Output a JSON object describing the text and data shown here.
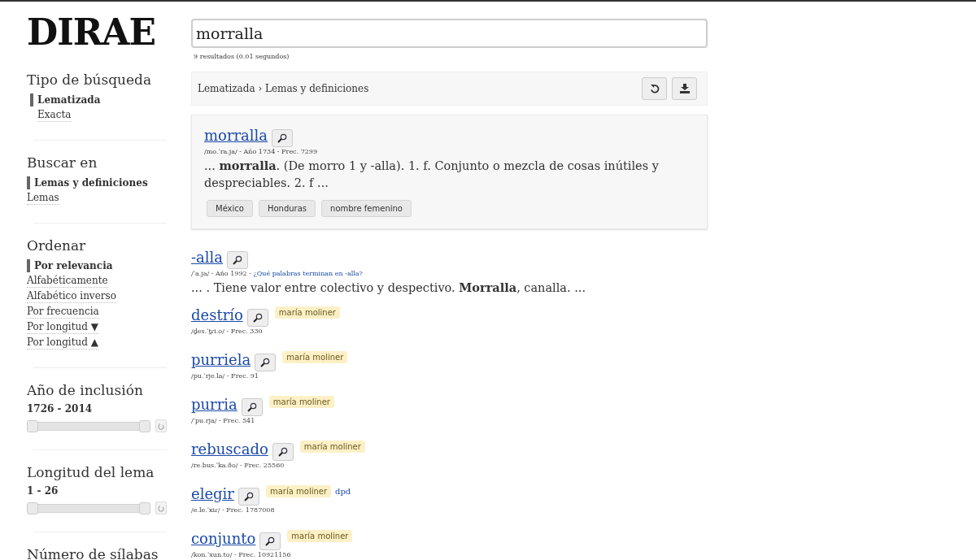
{
  "logo": "DIRAE",
  "search": {
    "value": "morralla",
    "stats": "9 resultados (0.01 segundos)"
  },
  "sidebar": {
    "sections": [
      {
        "kind": "options",
        "title": "Tipo de búsqueda",
        "options": [
          {
            "label": "Lematizada",
            "selected": true
          },
          {
            "label": "Exacta",
            "selected": false
          }
        ]
      },
      {
        "kind": "options",
        "title": "Buscar en",
        "options": [
          {
            "label": "Lemas y definiciones",
            "selected": true
          },
          {
            "label": "Lemas",
            "selected": false
          }
        ]
      },
      {
        "kind": "options",
        "title": "Ordenar",
        "options": [
          {
            "label": "Por relevancia",
            "selected": true
          },
          {
            "label": "Alfabéticamente",
            "selected": false
          },
          {
            "label": "Alfabético inverso",
            "selected": false
          },
          {
            "label": "Por frecuencia",
            "selected": false
          },
          {
            "label": "Por longitud ▼",
            "selected": false
          },
          {
            "label": "Por longitud ▲",
            "selected": false
          }
        ]
      },
      {
        "kind": "range",
        "title": "Año de inclusión",
        "range": "1726 - 2014",
        "level": 1
      },
      {
        "kind": "range",
        "title": "Longitud del lema",
        "range": "1 - 26",
        "level": 1
      },
      {
        "kind": "heading",
        "title": "Número de sílabas"
      }
    ]
  },
  "breadcrumb": "Lematizada › Lemas y definiciones",
  "results": [
    {
      "word": "morralla",
      "kind": "featured",
      "meta": "/mo.ˈra.ja/ - Año 1734 - Frec. 7299",
      "snippet": "... **morralla**. (De morro 1 y -alla). 1. f. Conjunto o mezcla de cosas inútiles y despreciables. 2. f ...",
      "tags": [
        "México",
        "Honduras",
        "nombre femenino"
      ]
    },
    {
      "word": "-alla",
      "kind": "plain",
      "meta": "/ˈa.ja/ - Año 1992 - ",
      "meta_link": "¿Qué palabras terminan en -alla?",
      "snippet": "... . Tiene valor entre colectivo y despectivo. **Morralla**, canalla. ..."
    },
    {
      "word": "destrío",
      "kind": "plain",
      "meta": "/d̪es.ˈt̪ɾi.o/ - Frec. 330",
      "badges": [
        {
          "kind": "source",
          "label": "maría moliner"
        }
      ]
    },
    {
      "word": "purriela",
      "kind": "plain",
      "meta": "/pu.ˈrje.la/ - Frec. 91",
      "badges": [
        {
          "kind": "source",
          "label": "maría moliner"
        }
      ]
    },
    {
      "word": "purria",
      "kind": "plain",
      "meta": "/ˈpu.rja/ - Frec. 541",
      "badges": [
        {
          "kind": "source",
          "label": "maría moliner"
        }
      ]
    },
    {
      "word": "rebuscado",
      "kind": "plain",
      "meta": "/re.bus.ˈka.ðo/ - Frec. 25560",
      "badges": [
        {
          "kind": "source",
          "label": "maría moliner"
        }
      ]
    },
    {
      "word": "elegir",
      "kind": "plain",
      "meta": "/e.le.ˈxiɾ/ - Frec. 1787008",
      "badges": [
        {
          "kind": "source",
          "label": "maría moliner"
        },
        {
          "kind": "link",
          "label": "dpd"
        }
      ]
    },
    {
      "word": "conjunto",
      "kind": "plain",
      "meta": "/kon.ˈxun.to/ - Frec. 10921156",
      "badges": [
        {
          "kind": "source",
          "label": "maría moliner"
        }
      ]
    }
  ]
}
